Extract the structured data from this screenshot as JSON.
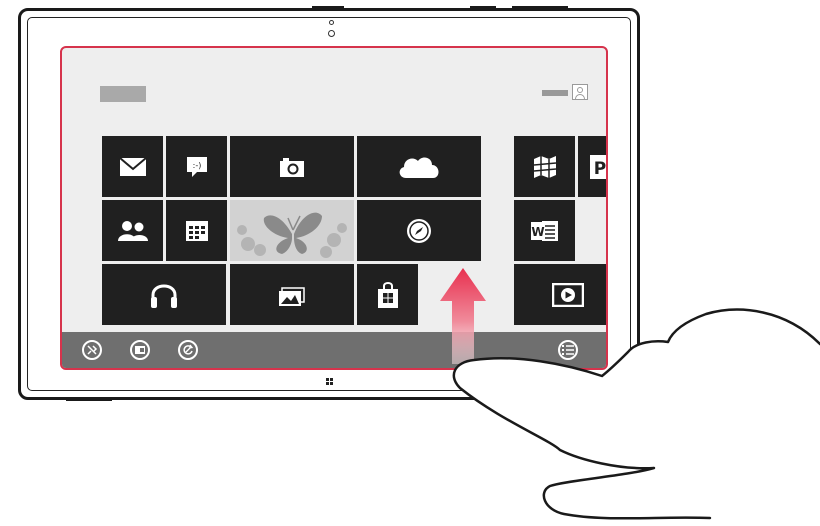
{
  "screen": {
    "tiles": [
      {
        "id": "mail",
        "icon": "mail-icon"
      },
      {
        "id": "messaging",
        "icon": "messaging-icon",
        "glyph": ":-)"
      },
      {
        "id": "camera",
        "icon": "camera-icon"
      },
      {
        "id": "skydrive",
        "icon": "cloud-icon"
      },
      {
        "id": "people",
        "icon": "people-icon"
      },
      {
        "id": "calendar",
        "icon": "calendar-icon"
      },
      {
        "id": "photos",
        "icon": "butterfly-photo-icon"
      },
      {
        "id": "internet",
        "icon": "compass-icon"
      },
      {
        "id": "music",
        "icon": "headphones-icon"
      },
      {
        "id": "gallery",
        "icon": "pictures-icon"
      },
      {
        "id": "store",
        "icon": "store-bag-icon"
      },
      {
        "id": "maps",
        "icon": "map-icon"
      },
      {
        "id": "powerpoint",
        "icon": "powerpoint-icon",
        "glyph": "P"
      },
      {
        "id": "word",
        "icon": "word-icon",
        "glyph": "W"
      },
      {
        "id": "video",
        "icon": "video-play-icon"
      }
    ],
    "appbar": [
      {
        "id": "unpin",
        "icon": "unpin-icon"
      },
      {
        "id": "resize",
        "icon": "resize-icon"
      },
      {
        "id": "turn-off-live-tile",
        "icon": "live-tile-off-icon"
      },
      {
        "id": "all-apps",
        "icon": "all-apps-icon"
      }
    ]
  },
  "gesture": {
    "direction": "up",
    "icon": "swipe-up-arrow-icon",
    "hand": "hand-icon"
  },
  "colors": {
    "screen_border": "#d6334c",
    "tile": "#202020",
    "appbar": "#6f6f6f",
    "arrow": "#e8304f"
  }
}
